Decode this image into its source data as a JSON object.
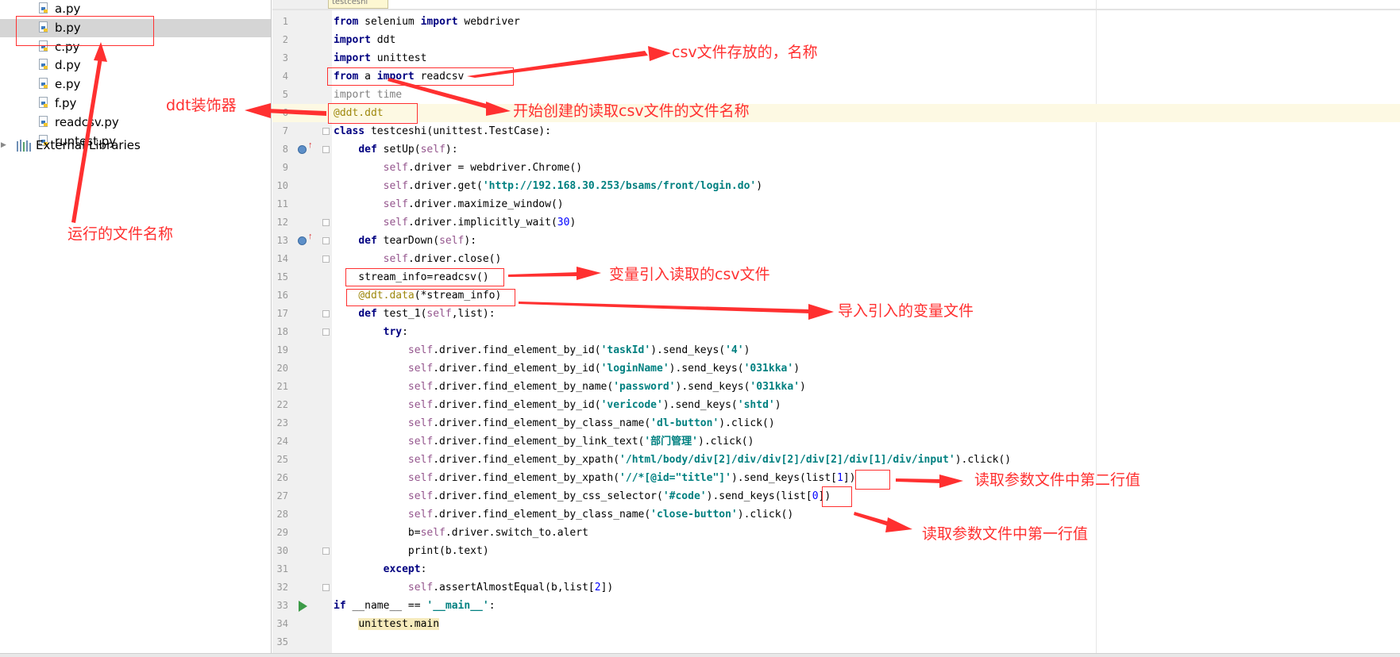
{
  "project_tree": {
    "items": [
      {
        "label": "a.py",
        "icon": "python-file-icon",
        "selected": false
      },
      {
        "label": "b.py",
        "icon": "python-file-icon",
        "selected": true
      },
      {
        "label": "c.py",
        "icon": "python-file-icon",
        "selected": false
      },
      {
        "label": "d.py",
        "icon": "python-file-icon",
        "selected": false
      },
      {
        "label": "e.py",
        "icon": "python-file-icon",
        "selected": false
      },
      {
        "label": "f.py",
        "icon": "python-file-icon",
        "selected": false
      },
      {
        "label": "readcsv.py",
        "icon": "python-file-icon",
        "selected": false
      },
      {
        "label": "runtest.py",
        "icon": "python-file-icon",
        "selected": false
      }
    ],
    "external_libraries": {
      "label": "External Libraries",
      "icon": "libraries-icon",
      "expand_icon": "expand-arrow-icon"
    }
  },
  "editor": {
    "tab_stub": "testceshi",
    "line_numbers": [
      "1",
      "2",
      "3",
      "4",
      "5",
      "6",
      "7",
      "8",
      "9",
      "10",
      "11",
      "12",
      "13",
      "14",
      "15",
      "16",
      "17",
      "18",
      "19",
      "20",
      "21",
      "22",
      "23",
      "24",
      "25",
      "26",
      "27",
      "28",
      "29",
      "30",
      "31",
      "32",
      "33",
      "34",
      "35"
    ],
    "lines": [
      "from selenium import webdriver",
      "import ddt",
      "import unittest",
      "from a import readcsv",
      "import time",
      "@ddt.ddt",
      "class testceshi(unittest.TestCase):",
      "    def setUp(self):",
      "        self.driver = webdriver.Chrome()",
      "        self.driver.get('http://192.168.30.253/bsams/front/login.do')",
      "        self.driver.maximize_window()",
      "        self.driver.implicitly_wait(30)",
      "    def tearDown(self):",
      "        self.driver.close()",
      "    stream_info=readcsv()",
      "    @ddt.data(*stream_info)",
      "    def test_1(self,list):",
      "        try:",
      "            self.driver.find_element_by_id('taskId').send_keys('4')",
      "            self.driver.find_element_by_id('loginName').send_keys('031kka')",
      "            self.driver.find_element_by_name('password').send_keys('031kka')",
      "            self.driver.find_element_by_id('vericode').send_keys('shtd')",
      "            self.driver.find_element_by_class_name('dl-button').click()",
      "            self.driver.find_element_by_link_text('部门管理').click()",
      "            self.driver.find_element_by_xpath('/html/body/div[2]/div/div[2]/div[2]/div[1]/div/input').click()",
      "            self.driver.find_element_by_xpath('//*[@id=\"title\"]').send_keys(list[1])",
      "            self.driver.find_element_by_css_selector('#code').send_keys(list[0])",
      "            self.driver.find_element_by_class_name('close-button').click()",
      "            b=self.driver.switch_to.alert",
      "            print(b.text)",
      "        except:",
      "            self.assertAlmostEqual(b,list[2])",
      "if __name__ == '__main__':",
      "    unittest.main",
      ""
    ]
  },
  "annotations": {
    "csv_file_name": "csv文件存放的，名称",
    "ddt_decorator": "ddt装饰器",
    "readcsv_function_name": "开始创建的读取csv文件的文件名称",
    "run_file_name": "运行的文件名称",
    "variable_reads_csv": "变量引入读取的csv文件",
    "import_variable": "导入引入的变量文件",
    "read_second_row": "读取参数文件中第二行值",
    "read_first_row": "读取参数文件中第一行值"
  },
  "colors": {
    "annotation": "#ff3030",
    "keyword": "#000080",
    "string": "#008080",
    "self": "#94558d",
    "number": "#0000ff",
    "selection": "#d5d5d5",
    "caret_row": "#fdf9e3"
  }
}
